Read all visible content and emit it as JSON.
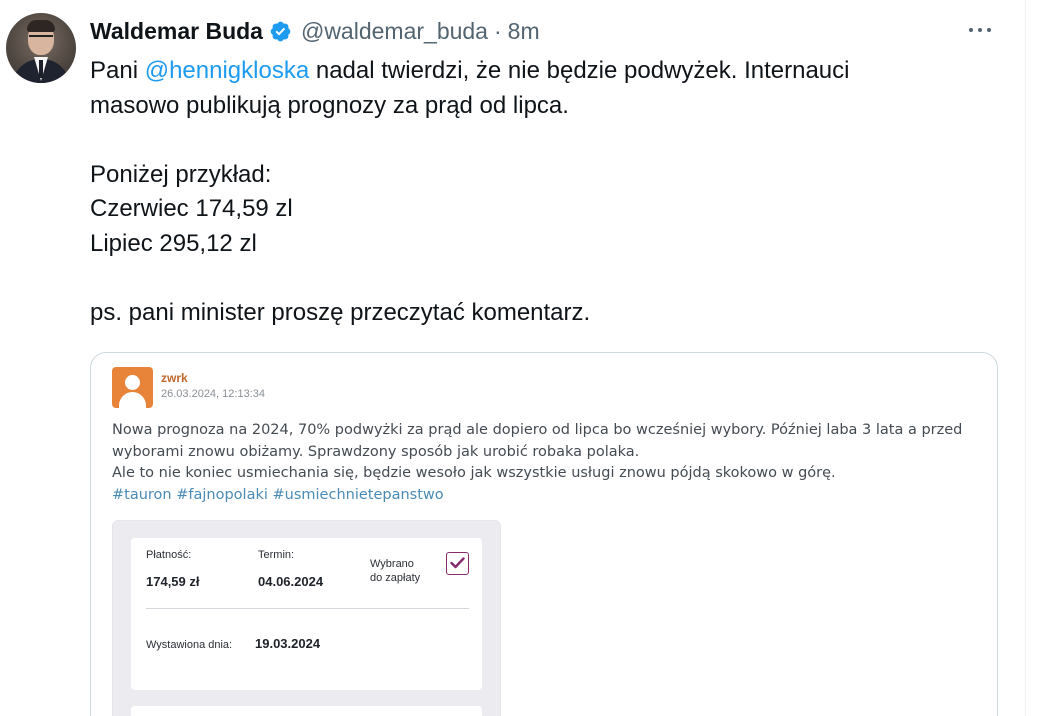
{
  "author": {
    "name": "Waldemar Buda",
    "handle": "@waldemar_buda",
    "separator": "·",
    "time": "8m"
  },
  "icons": {
    "verified": "verified-badge-icon",
    "more": "more-options-icon",
    "verified_color": "#1d9bf0"
  },
  "tweet": {
    "line1_pre": "Pani ",
    "line1_mention": "@hennigkloska",
    "line1_post": " nadal twierdzi, że nie będzie podwyżek. Internauci",
    "line2": "masowo publikują prognozy za prąd od lipca.",
    "line3": "Poniżej przykład:",
    "line4": "Czerwiec 174,59 zl",
    "line5": "Lipiec 295,12 zl",
    "line6": "ps. pani minister proszę przeczytać komentarz."
  },
  "embedded_post": {
    "username": "zwrk",
    "date": "26.03.2024, 12:13:34",
    "line1": "Nowa prognoza na 2024, 70% podwyżki za prąd ale dopiero od lipca bo wcześniej wybory. Później laba 3 lata a przed",
    "line2": "wyborami znowu obiżamy. Sprawdzony sposób jak urobić robaka polaka.",
    "line3": "Ale to nie koniec usmiechania się, będzie wesoło jak wszystkie usługi znowu pójdą skokowo w górę.",
    "hashtags": [
      "#tauron",
      "#fajnopolaki",
      "#usmiechnietepanstwo"
    ]
  },
  "invoice": {
    "payment_label": "Płatność:",
    "payment_value": "174,59 zł",
    "due_label": "Termin:",
    "due_value": "04.06.2024",
    "selected_label_1": "Wybrano",
    "selected_label_2": "do zapłaty",
    "selected_checked": true,
    "issued_label": "Wystawiona dnia:",
    "issued_value": "19.03.2024",
    "check_color": "#8a2a6e"
  }
}
